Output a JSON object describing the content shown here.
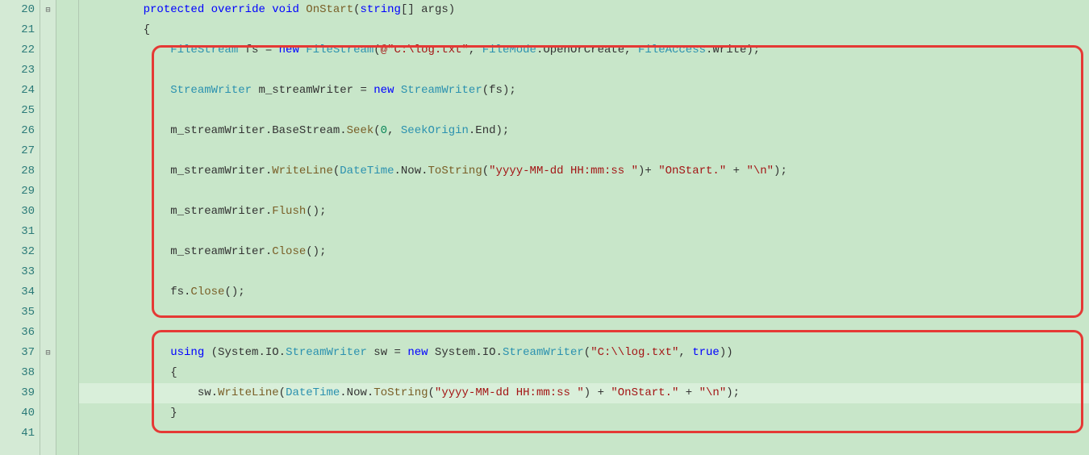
{
  "lineNumbers": [
    "20",
    "21",
    "22",
    "23",
    "24",
    "25",
    "26",
    "27",
    "28",
    "29",
    "30",
    "31",
    "32",
    "33",
    "34",
    "35",
    "36",
    "37",
    "38",
    "39",
    "40",
    "41"
  ],
  "foldMarkers": {
    "0": "⊟",
    "17": "⊟"
  },
  "code": {
    "l20": [
      {
        "cls": "plain",
        "t": "         "
      },
      {
        "cls": "kw",
        "t": "protected"
      },
      {
        "cls": "plain",
        "t": " "
      },
      {
        "cls": "kw",
        "t": "override"
      },
      {
        "cls": "plain",
        "t": " "
      },
      {
        "cls": "kw",
        "t": "void"
      },
      {
        "cls": "plain",
        "t": " "
      },
      {
        "cls": "method",
        "t": "OnStart"
      },
      {
        "cls": "plain",
        "t": "("
      },
      {
        "cls": "kw",
        "t": "string"
      },
      {
        "cls": "plain",
        "t": "[] "
      },
      {
        "cls": "plain",
        "t": "args"
      },
      {
        "cls": "plain",
        "t": ")"
      }
    ],
    "l21": [
      {
        "cls": "plain",
        "t": "         {"
      }
    ],
    "l22": [
      {
        "cls": "plain",
        "t": "             "
      },
      {
        "cls": "type",
        "t": "FileStream"
      },
      {
        "cls": "plain",
        "t": " fs = "
      },
      {
        "cls": "kw",
        "t": "new"
      },
      {
        "cls": "plain",
        "t": " "
      },
      {
        "cls": "type",
        "t": "FileStream"
      },
      {
        "cls": "plain",
        "t": "("
      },
      {
        "cls": "str",
        "t": "@\"C:\\log.txt\""
      },
      {
        "cls": "plain",
        "t": ", "
      },
      {
        "cls": "type",
        "t": "FileMode"
      },
      {
        "cls": "plain",
        "t": ".OpenOrCreate, "
      },
      {
        "cls": "type",
        "t": "FileAccess"
      },
      {
        "cls": "plain",
        "t": ".Write);"
      }
    ],
    "l23": [
      {
        "cls": "plain",
        "t": ""
      }
    ],
    "l24": [
      {
        "cls": "plain",
        "t": "             "
      },
      {
        "cls": "type",
        "t": "StreamWriter"
      },
      {
        "cls": "plain",
        "t": " m_streamWriter = "
      },
      {
        "cls": "kw",
        "t": "new"
      },
      {
        "cls": "plain",
        "t": " "
      },
      {
        "cls": "type",
        "t": "StreamWriter"
      },
      {
        "cls": "plain",
        "t": "(fs);"
      }
    ],
    "l25": [
      {
        "cls": "plain",
        "t": ""
      }
    ],
    "l26": [
      {
        "cls": "plain",
        "t": "             m_streamWriter.BaseStream."
      },
      {
        "cls": "method",
        "t": "Seek"
      },
      {
        "cls": "plain",
        "t": "("
      },
      {
        "cls": "num",
        "t": "0"
      },
      {
        "cls": "plain",
        "t": ", "
      },
      {
        "cls": "type",
        "t": "SeekOrigin"
      },
      {
        "cls": "plain",
        "t": ".End);"
      }
    ],
    "l27": [
      {
        "cls": "plain",
        "t": ""
      }
    ],
    "l28": [
      {
        "cls": "plain",
        "t": "             m_streamWriter."
      },
      {
        "cls": "method",
        "t": "WriteLine"
      },
      {
        "cls": "plain",
        "t": "("
      },
      {
        "cls": "type",
        "t": "DateTime"
      },
      {
        "cls": "plain",
        "t": ".Now."
      },
      {
        "cls": "method",
        "t": "ToString"
      },
      {
        "cls": "plain",
        "t": "("
      },
      {
        "cls": "str",
        "t": "\"yyyy-MM-dd HH:mm:ss \""
      },
      {
        "cls": "plain",
        "t": ")+ "
      },
      {
        "cls": "str",
        "t": "\"OnStart.\""
      },
      {
        "cls": "plain",
        "t": " + "
      },
      {
        "cls": "str",
        "t": "\"\\n\""
      },
      {
        "cls": "plain",
        "t": ");"
      }
    ],
    "l29": [
      {
        "cls": "plain",
        "t": ""
      }
    ],
    "l30": [
      {
        "cls": "plain",
        "t": "             m_streamWriter."
      },
      {
        "cls": "method",
        "t": "Flush"
      },
      {
        "cls": "plain",
        "t": "();"
      }
    ],
    "l31": [
      {
        "cls": "plain",
        "t": ""
      }
    ],
    "l32": [
      {
        "cls": "plain",
        "t": "             m_streamWriter."
      },
      {
        "cls": "method",
        "t": "Close"
      },
      {
        "cls": "plain",
        "t": "();"
      }
    ],
    "l33": [
      {
        "cls": "plain",
        "t": ""
      }
    ],
    "l34": [
      {
        "cls": "plain",
        "t": "             fs."
      },
      {
        "cls": "method",
        "t": "Close"
      },
      {
        "cls": "plain",
        "t": "();"
      }
    ],
    "l35": [
      {
        "cls": "plain",
        "t": ""
      }
    ],
    "l36": [
      {
        "cls": "plain",
        "t": ""
      }
    ],
    "l37": [
      {
        "cls": "plain",
        "t": "             "
      },
      {
        "cls": "kw",
        "t": "using"
      },
      {
        "cls": "plain",
        "t": " (System.IO."
      },
      {
        "cls": "type",
        "t": "StreamWriter"
      },
      {
        "cls": "plain",
        "t": " sw = "
      },
      {
        "cls": "kw",
        "t": "new"
      },
      {
        "cls": "plain",
        "t": " System.IO."
      },
      {
        "cls": "type",
        "t": "StreamWriter"
      },
      {
        "cls": "plain",
        "t": "("
      },
      {
        "cls": "str",
        "t": "\"C:\\\\log.txt\""
      },
      {
        "cls": "plain",
        "t": ", "
      },
      {
        "cls": "kw",
        "t": "true"
      },
      {
        "cls": "plain",
        "t": "))"
      }
    ],
    "l38": [
      {
        "cls": "plain",
        "t": "             {"
      }
    ],
    "l39": [
      {
        "cls": "plain",
        "t": "                 sw."
      },
      {
        "cls": "method",
        "t": "WriteLine"
      },
      {
        "cls": "plain",
        "t": "("
      },
      {
        "cls": "type",
        "t": "DateTime"
      },
      {
        "cls": "plain",
        "t": ".Now."
      },
      {
        "cls": "method",
        "t": "ToString"
      },
      {
        "cls": "plain",
        "t": "("
      },
      {
        "cls": "str",
        "t": "\"yyyy-MM-dd HH:mm:ss \""
      },
      {
        "cls": "plain",
        "t": ") + "
      },
      {
        "cls": "str",
        "t": "\"OnStart.\""
      },
      {
        "cls": "plain",
        "t": " + "
      },
      {
        "cls": "str",
        "t": "\"\\n\""
      },
      {
        "cls": "plain",
        "t": ");"
      }
    ],
    "l40": [
      {
        "cls": "plain",
        "t": "             }"
      }
    ],
    "l41": [
      {
        "cls": "plain",
        "t": ""
      }
    ]
  },
  "highlightLine": 19,
  "pencilIcon": "🖉"
}
